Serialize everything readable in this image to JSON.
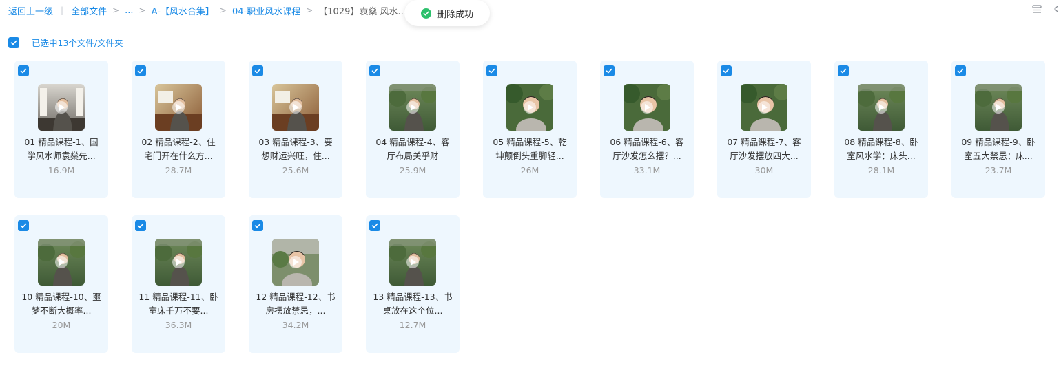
{
  "breadcrumb": {
    "back": "返回上一级",
    "all_files": "全部文件",
    "ellipsis": "...",
    "crumb_1": "A-【风水合集】",
    "crumb_2": "04-职业风水课程",
    "current": "【1029】袁燊 风水..."
  },
  "toast": {
    "text": "删除成功"
  },
  "selection": {
    "label": "已选中13个文件/文件夹"
  },
  "files": [
    {
      "name": "01 精品课程-1、国学风水师袁燊先...",
      "size": "16.9M",
      "thumb": "study"
    },
    {
      "name": "02 精品课程-2、住宅门开在什么方...",
      "size": "28.7M",
      "thumb": "interior"
    },
    {
      "name": "03 精品课程-3、要想财运兴旺，住...",
      "size": "25.6M",
      "thumb": "interior"
    },
    {
      "name": "04 精品课程-4、客厅布局关乎财",
      "size": "25.9M",
      "thumb": "garden"
    },
    {
      "name": "05 精品课程-5、乾坤颠倒头重脚轻...",
      "size": "26M",
      "thumb": "closeup"
    },
    {
      "name": "06 精品课程-6、客厅沙发怎么摆？...",
      "size": "33.1M",
      "thumb": "closeup"
    },
    {
      "name": "07 精品课程-7、客厅沙发摆放四大...",
      "size": "30M",
      "thumb": "closeup"
    },
    {
      "name": "08 精品课程-8、卧室风水学：床头...",
      "size": "28.1M",
      "thumb": "garden"
    },
    {
      "name": "09 精品课程-9、卧室五大禁忌：床...",
      "size": "23.7M",
      "thumb": "garden"
    },
    {
      "name": "10 精品课程-10、噩梦不断大概率...",
      "size": "20M",
      "thumb": "garden"
    },
    {
      "name": "11 精品课程-11、卧室床千万不要...",
      "size": "36.3M",
      "thumb": "garden"
    },
    {
      "name": "12 精品课程-12、书房摆放禁忌，...",
      "size": "34.2M",
      "thumb": "outdoor"
    },
    {
      "name": "13 精品课程-13、书桌放在这个位...",
      "size": "12.7M",
      "thumb": "garden"
    }
  ]
}
